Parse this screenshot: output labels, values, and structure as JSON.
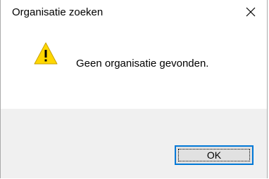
{
  "window": {
    "title": "Organisatie zoeken",
    "close_icon": "close-icon"
  },
  "message": {
    "icon": "warning-icon",
    "text": "Geen organisatie gevonden."
  },
  "buttons": {
    "ok_label": "OK"
  },
  "colors": {
    "warning_fill": "#ffd700",
    "accent_border": "#0078d7",
    "footer_bg": "#f0f0f0",
    "button_bg": "#e1e1e1"
  }
}
